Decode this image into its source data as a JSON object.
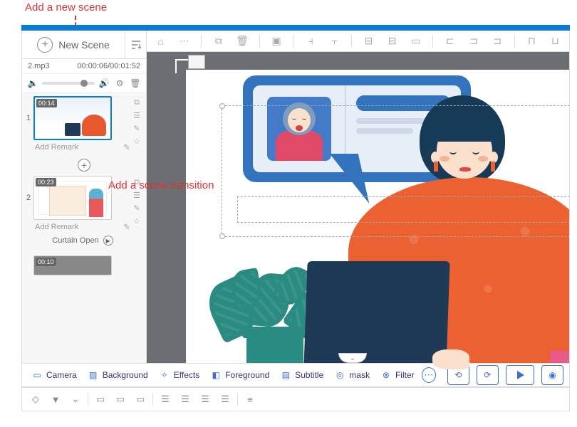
{
  "annotations": {
    "new_scene": "Add a new scene",
    "transition": "Add a scene transition"
  },
  "sidebar": {
    "new_scene_label": "New Scene",
    "audio": {
      "filename": "2.mp3",
      "time": "00:00:06/00:01:52"
    },
    "scenes": [
      {
        "num": "1",
        "duration": "00:14",
        "remark_placeholder": "Add Remark"
      },
      {
        "num": "2",
        "duration": "00:23",
        "remark_placeholder": "Add Remark",
        "transition_name": "Curtain Open"
      },
      {
        "num": "",
        "duration": "00:10",
        "remark_placeholder": ""
      }
    ]
  },
  "bottom": {
    "buttons": [
      "Camera",
      "Background",
      "Effects",
      "Foreground",
      "Subtitle",
      "mask",
      "Filter"
    ]
  }
}
